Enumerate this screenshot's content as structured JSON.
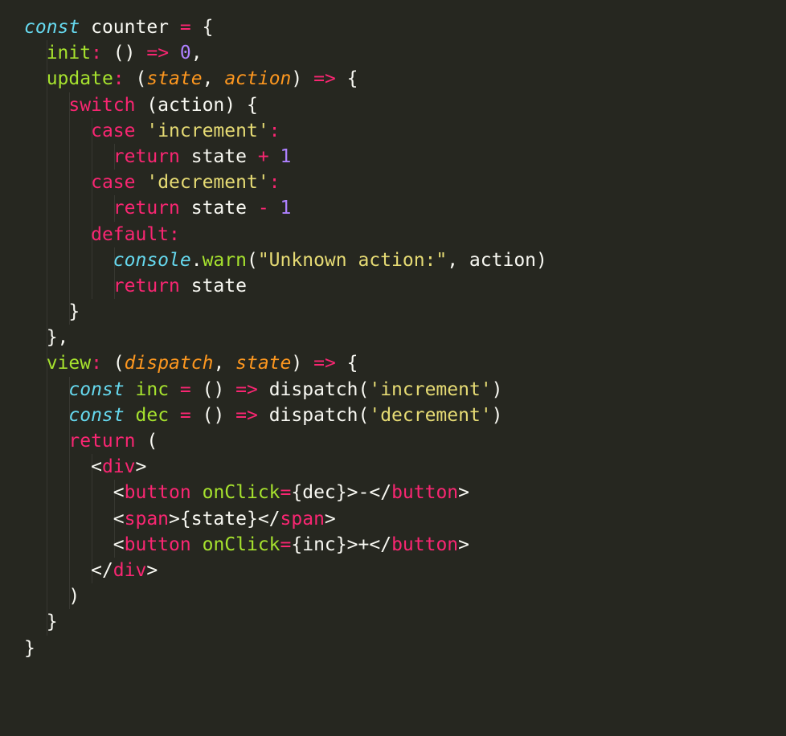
{
  "code": {
    "lines": [
      {
        "indent": 0,
        "tokens": [
          [
            "kw",
            "const"
          ],
          [
            "punc",
            " counter "
          ],
          [
            "op",
            "="
          ],
          [
            "punc",
            " {"
          ]
        ]
      },
      {
        "indent": 1,
        "tokens": [
          [
            "fn",
            "init"
          ],
          [
            "op",
            ":"
          ],
          [
            "punc",
            " () "
          ],
          [
            "op",
            "=>"
          ],
          [
            "punc",
            " "
          ],
          [
            "num",
            "0"
          ],
          [
            "punc",
            ","
          ]
        ]
      },
      {
        "indent": 1,
        "tokens": [
          [
            "fn",
            "update"
          ],
          [
            "op",
            ":"
          ],
          [
            "punc",
            " ("
          ],
          [
            "param",
            "state"
          ],
          [
            "punc",
            ", "
          ],
          [
            "param",
            "action"
          ],
          [
            "punc",
            ") "
          ],
          [
            "op",
            "=>"
          ],
          [
            "punc",
            " {"
          ]
        ]
      },
      {
        "indent": 2,
        "tokens": [
          [
            "kw2",
            "switch"
          ],
          [
            "punc",
            " (action) {"
          ]
        ]
      },
      {
        "indent": 3,
        "tokens": [
          [
            "kw2",
            "case"
          ],
          [
            "punc",
            " "
          ],
          [
            "str",
            "'increment'"
          ],
          [
            "op",
            ":"
          ]
        ]
      },
      {
        "indent": 4,
        "tokens": [
          [
            "kw2",
            "return"
          ],
          [
            "punc",
            " state "
          ],
          [
            "op",
            "+"
          ],
          [
            "punc",
            " "
          ],
          [
            "num",
            "1"
          ]
        ]
      },
      {
        "indent": 3,
        "tokens": [
          [
            "kw2",
            "case"
          ],
          [
            "punc",
            " "
          ],
          [
            "str",
            "'decrement'"
          ],
          [
            "op",
            ":"
          ]
        ]
      },
      {
        "indent": 4,
        "tokens": [
          [
            "kw2",
            "return"
          ],
          [
            "punc",
            " state "
          ],
          [
            "op",
            "-"
          ],
          [
            "punc",
            " "
          ],
          [
            "num",
            "1"
          ]
        ]
      },
      {
        "indent": 3,
        "tokens": [
          [
            "kw2",
            "default"
          ],
          [
            "op",
            ":"
          ]
        ]
      },
      {
        "indent": 4,
        "tokens": [
          [
            "obj",
            "console"
          ],
          [
            "punc",
            "."
          ],
          [
            "fn",
            "warn"
          ],
          [
            "punc",
            "("
          ],
          [
            "str",
            "\"Unknown action:\""
          ],
          [
            "punc",
            ", action)"
          ]
        ]
      },
      {
        "indent": 4,
        "tokens": [
          [
            "kw2",
            "return"
          ],
          [
            "punc",
            " state"
          ]
        ]
      },
      {
        "indent": 2,
        "tokens": [
          [
            "punc",
            "}"
          ]
        ]
      },
      {
        "indent": 1,
        "tokens": [
          [
            "punc",
            "},"
          ]
        ]
      },
      {
        "indent": 1,
        "tokens": [
          [
            "fn",
            "view"
          ],
          [
            "op",
            ":"
          ],
          [
            "punc",
            " ("
          ],
          [
            "param",
            "dispatch"
          ],
          [
            "punc",
            ", "
          ],
          [
            "param",
            "state"
          ],
          [
            "punc",
            ") "
          ],
          [
            "op",
            "=>"
          ],
          [
            "punc",
            " {"
          ]
        ]
      },
      {
        "indent": 2,
        "tokens": [
          [
            "kw",
            "const"
          ],
          [
            "punc",
            " "
          ],
          [
            "fn",
            "inc"
          ],
          [
            "punc",
            " "
          ],
          [
            "op",
            "="
          ],
          [
            "punc",
            " () "
          ],
          [
            "op",
            "=>"
          ],
          [
            "punc",
            " dispatch("
          ],
          [
            "str",
            "'increment'"
          ],
          [
            "punc",
            ")"
          ]
        ]
      },
      {
        "indent": 2,
        "tokens": [
          [
            "kw",
            "const"
          ],
          [
            "punc",
            " "
          ],
          [
            "fn",
            "dec"
          ],
          [
            "punc",
            " "
          ],
          [
            "op",
            "="
          ],
          [
            "punc",
            " () "
          ],
          [
            "op",
            "=>"
          ],
          [
            "punc",
            " dispatch("
          ],
          [
            "str",
            "'decrement'"
          ],
          [
            "punc",
            ")"
          ]
        ]
      },
      {
        "indent": 2,
        "tokens": [
          [
            "kw2",
            "return"
          ],
          [
            "punc",
            " ("
          ]
        ]
      },
      {
        "indent": 3,
        "tokens": [
          [
            "tagp",
            "<"
          ],
          [
            "tag",
            "div"
          ],
          [
            "tagp",
            ">"
          ]
        ]
      },
      {
        "indent": 4,
        "tokens": [
          [
            "tagp",
            "<"
          ],
          [
            "tag",
            "button"
          ],
          [
            "punc",
            " "
          ],
          [
            "attr",
            "onClick"
          ],
          [
            "op",
            "="
          ],
          [
            "punc",
            "{dec}"
          ],
          [
            "tagp",
            ">"
          ],
          [
            "punc",
            "-"
          ],
          [
            "tagp",
            "</"
          ],
          [
            "tag",
            "button"
          ],
          [
            "tagp",
            ">"
          ]
        ]
      },
      {
        "indent": 4,
        "tokens": [
          [
            "tagp",
            "<"
          ],
          [
            "tag",
            "span"
          ],
          [
            "tagp",
            ">"
          ],
          [
            "punc",
            "{state}"
          ],
          [
            "tagp",
            "</"
          ],
          [
            "tag",
            "span"
          ],
          [
            "tagp",
            ">"
          ]
        ]
      },
      {
        "indent": 4,
        "tokens": [
          [
            "tagp",
            "<"
          ],
          [
            "tag",
            "button"
          ],
          [
            "punc",
            " "
          ],
          [
            "attr",
            "onClick"
          ],
          [
            "op",
            "="
          ],
          [
            "punc",
            "{inc}"
          ],
          [
            "tagp",
            ">"
          ],
          [
            "punc",
            "+"
          ],
          [
            "tagp",
            "</"
          ],
          [
            "tag",
            "button"
          ],
          [
            "tagp",
            ">"
          ]
        ]
      },
      {
        "indent": 3,
        "tokens": [
          [
            "tagp",
            "</"
          ],
          [
            "tag",
            "div"
          ],
          [
            "tagp",
            ">"
          ]
        ]
      },
      {
        "indent": 2,
        "tokens": [
          [
            "punc",
            ")"
          ]
        ]
      },
      {
        "indent": 1,
        "tokens": [
          [
            "punc",
            "}"
          ]
        ]
      },
      {
        "indent": 0,
        "tokens": [
          [
            "punc",
            "}"
          ]
        ]
      }
    ],
    "indent_string": "  "
  }
}
